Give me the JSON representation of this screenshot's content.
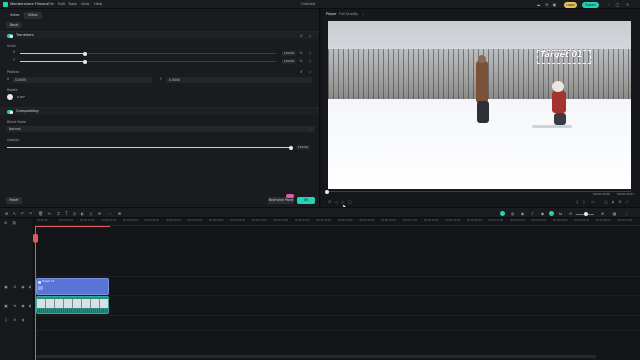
{
  "app": {
    "name": "Wondershare Filmora",
    "project_title": "Untitled",
    "menu": [
      "File",
      "Edit",
      "Tools",
      "View",
      "Help"
    ],
    "login_label": "Login",
    "export_label": "Export"
  },
  "left_panel": {
    "tabs": [
      "Video",
      "Video"
    ],
    "subtab": "Basic",
    "transform": {
      "title": "Transform",
      "scale_label": "Scale",
      "scale_x_value": "100.00",
      "scale_y_value": "100.00",
      "position_label": "Position",
      "position_x_value": "0.0000",
      "position_y_value": "0.0000",
      "rotate_label": "Rotate",
      "rotate_value": "0.00°"
    },
    "compositing": {
      "title": "Compositing",
      "blend_mode_label": "Blend Mode",
      "blend_mode_value": "Normal",
      "opacity_label": "Opacity",
      "opacity_value": "100.00",
      "opacity_fraction": 1.0
    },
    "reset_label": "Reset",
    "keyframe_label": "Keyframe Panel",
    "ok_label": "OK"
  },
  "player": {
    "tab_player": "Player",
    "tab_quality": "Full Quality",
    "overlay_text": "Target 01",
    "time_current": "00:00:00:00",
    "time_total": "00:00:18:27",
    "progress_fraction": 0.0
  },
  "timeline": {
    "ruler_labels": [
      "00:00:00",
      "00:00:01:00",
      "00:00:02:00",
      "00:00:03:00",
      "00:00:04:00",
      "00:00:05:00",
      "00:00:06:00",
      "00:00:07:00",
      "00:00:08:00",
      "00:00:09:00",
      "00:00:10:00",
      "00:00:11:00",
      "00:00:12:00",
      "00:00:13:00",
      "00:00:14:00",
      "00:00:15:00",
      "00:00:16:00",
      "00:00:17:00",
      "00:00:18:00",
      "00:00:19:00",
      "00:00:20:00",
      "00:00:21:00",
      "00:00:22:00",
      "00:00:23:00",
      "00:00:24:00",
      "00:00:25:00",
      "00:00:26:00",
      "00:00:27:00"
    ],
    "title_clip_label": "Target 01"
  },
  "colors": {
    "accent": "#23d3b4",
    "playhead": "#e0585f",
    "title_clip": "#5a74d6",
    "video_clip": "#2a8d7d"
  }
}
